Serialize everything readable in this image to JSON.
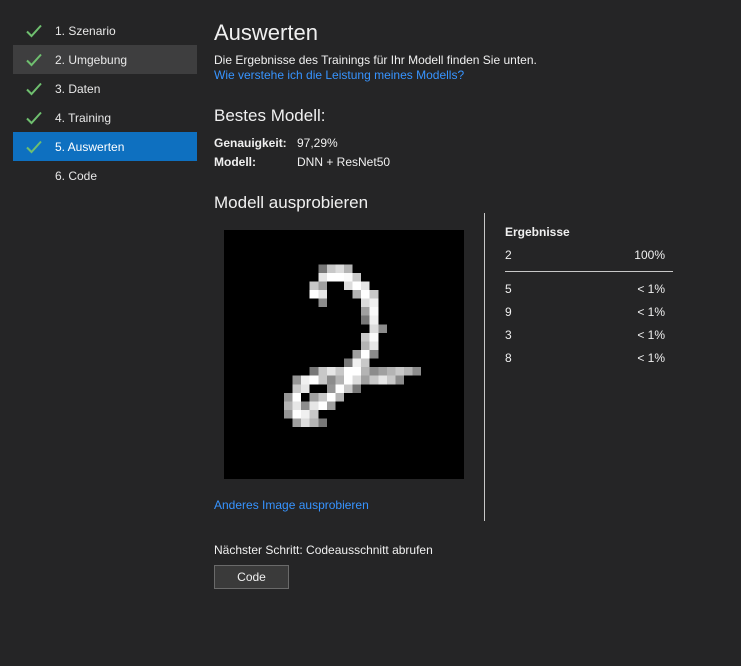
{
  "sidebar": {
    "steps": [
      {
        "label": "1. Szenario",
        "done": true
      },
      {
        "label": "2. Umgebung",
        "done": true
      },
      {
        "label": "3. Daten",
        "done": true
      },
      {
        "label": "4. Training",
        "done": true
      },
      {
        "label": "5. Auswerten",
        "done": true
      },
      {
        "label": "6. Code",
        "done": false
      }
    ],
    "active_index": 4,
    "hover_index": 1
  },
  "main": {
    "title": "Auswerten",
    "subtitle": "Die Ergebnisse des Trainings für Ihr Modell finden Sie unten.",
    "help_link": "Wie verstehe ich die Leistung meines Modells?"
  },
  "best_model": {
    "heading": "Bestes Modell:",
    "accuracy_label": "Genauigkeit:",
    "accuracy_value": "97,29%",
    "model_label": "Modell:",
    "model_value": "DNN + ResNet50"
  },
  "try_model": {
    "heading": "Modell ausprobieren",
    "image_alt": "handwritten digit 2",
    "other_image_link": "Anderes Image ausprobieren"
  },
  "results": {
    "heading": "Ergebnisse",
    "top": {
      "label": "2",
      "value": "100%"
    },
    "others": [
      {
        "label": "5",
        "value": "< 1%"
      },
      {
        "label": "9",
        "value": "< 1%"
      },
      {
        "label": "3",
        "value": "< 1%"
      },
      {
        "label": "8",
        "value": "< 1%"
      }
    ]
  },
  "next_step": {
    "text": "Nächster Schritt: Codeausschnitt abrufen",
    "button_label": "Code"
  },
  "colors": {
    "background": "#252526",
    "accent": "#0e70c0",
    "link": "#3794ff",
    "check": "#6fbf6f"
  },
  "icons": {
    "step_done": "check-icon"
  }
}
